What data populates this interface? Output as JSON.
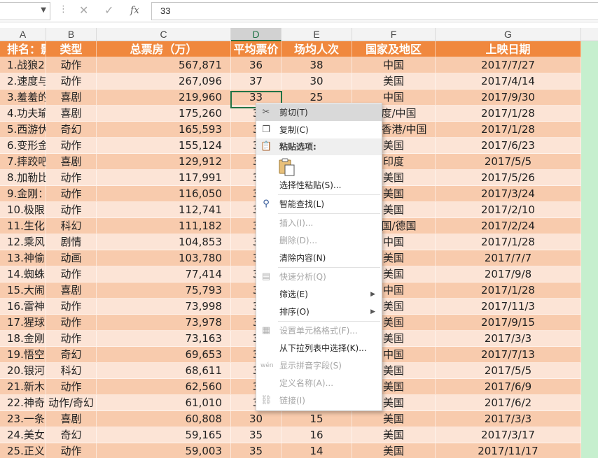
{
  "formula_bar": {
    "namebox_value": "",
    "cancel_icon": "✕",
    "enter_icon": "✓",
    "fx_label": "fx",
    "formula_value": "33"
  },
  "columns": [
    "A",
    "B",
    "C",
    "D",
    "E",
    "F",
    "G"
  ],
  "selected_column": "D",
  "table_header": [
    "排名：影片",
    "类型",
    "总票房（万）",
    "平均票价",
    "场均人次",
    "国家及地区",
    "上映日期"
  ],
  "rows": [
    [
      "1.战狼2",
      "动作",
      "567,871",
      "36",
      "38",
      "中国",
      "2017/7/27"
    ],
    [
      "2.速度与",
      "动作",
      "267,096",
      "37",
      "30",
      "美国",
      "2017/4/14"
    ],
    [
      "3.羞羞的",
      "喜剧",
      "219,960",
      "33",
      "25",
      "中国",
      "2017/9/30"
    ],
    [
      "4.功夫瑜",
      "喜剧",
      "175,260",
      "3",
      "",
      "印度/中国",
      "2017/1/28"
    ],
    [
      "5.西游伏",
      "奇幻",
      "165,593",
      "3",
      "",
      "中国香港/中国",
      "2017/1/28"
    ],
    [
      "6.变形金",
      "动作",
      "155,124",
      "3",
      "",
      "美国",
      "2017/6/23"
    ],
    [
      "7.摔跤吧",
      "喜剧",
      "129,912",
      "3",
      "",
      "印度",
      "2017/5/5"
    ],
    [
      "8.加勒比",
      "动作",
      "117,991",
      "3",
      "",
      "美国",
      "2017/5/26"
    ],
    [
      "9.金刚：",
      "动作",
      "116,050",
      "3",
      "",
      "美国",
      "2017/3/24"
    ],
    [
      "10.极限",
      "动作",
      "112,741",
      "3",
      "",
      "美国",
      "2017/2/10"
    ],
    [
      "11.生化",
      "科幻",
      "111,182",
      "3",
      "",
      "美国/德国",
      "2017/2/24"
    ],
    [
      "12.乘风",
      "剧情",
      "104,853",
      "3",
      "",
      "中国",
      "2017/1/28"
    ],
    [
      "13.神偷",
      "动画",
      "103,780",
      "3",
      "",
      "美国",
      "2017/7/7"
    ],
    [
      "14.蜘蛛",
      "动作",
      "77,414",
      "3",
      "",
      "美国",
      "2017/9/8"
    ],
    [
      "15.大闹",
      "喜剧",
      "75,793",
      "3",
      "",
      "中国",
      "2017/1/28"
    ],
    [
      "16.雷神",
      "动作",
      "73,998",
      "3",
      "",
      "美国",
      "2017/11/3"
    ],
    [
      "17.猩球",
      "动作",
      "73,978",
      "3",
      "",
      "美国",
      "2017/9/15"
    ],
    [
      "18.金刚",
      "动作",
      "73,163",
      "3",
      "",
      "美国",
      "2017/3/3"
    ],
    [
      "19.悟空",
      "奇幻",
      "69,653",
      "3",
      "",
      "中国",
      "2017/7/13"
    ],
    [
      "20.银河",
      "科幻",
      "68,611",
      "3",
      "",
      "美国",
      "2017/5/5"
    ],
    [
      "21.新木",
      "动作",
      "62,560",
      "3",
      "",
      "美国",
      "2017/6/9"
    ],
    [
      "22.神奇",
      "动作/奇幻",
      "61,010",
      "3",
      "",
      "美国",
      "2017/6/2"
    ],
    [
      "23.一条",
      "喜剧",
      "60,808",
      "30",
      "15",
      "美国",
      "2017/3/3"
    ],
    [
      "24.美女",
      "奇幻",
      "59,165",
      "35",
      "16",
      "美国",
      "2017/3/17"
    ],
    [
      "25.正义",
      "动作",
      "59,003",
      "35",
      "14",
      "美国",
      "2017/11/17"
    ]
  ],
  "context_menu": {
    "cut": "剪切(T)",
    "copy": "复制(C)",
    "paste_options": "粘贴选项:",
    "paste_special": "选择性粘贴(S)...",
    "smart_lookup": "智能查找(L)",
    "insert": "插入(I)...",
    "delete": "删除(D)...",
    "clear_contents": "清除内容(N)",
    "quick_analysis": "快速分析(Q)",
    "filter": "筛选(E)",
    "sort": "排序(O)",
    "format_cells": "设置单元格格式(F)...",
    "pick_from_list": "从下拉列表中选择(K)...",
    "show_phonetic": "显示拼音字段(S)",
    "define_name": "定义名称(A)...",
    "link": "链接(I)"
  },
  "colors": {
    "header_bg": "#f0883e",
    "row_odd_bg": "#f8cbad",
    "row_even_bg": "#fce4d6",
    "selection_border": "#217346",
    "right_strip": "#c6efce"
  }
}
